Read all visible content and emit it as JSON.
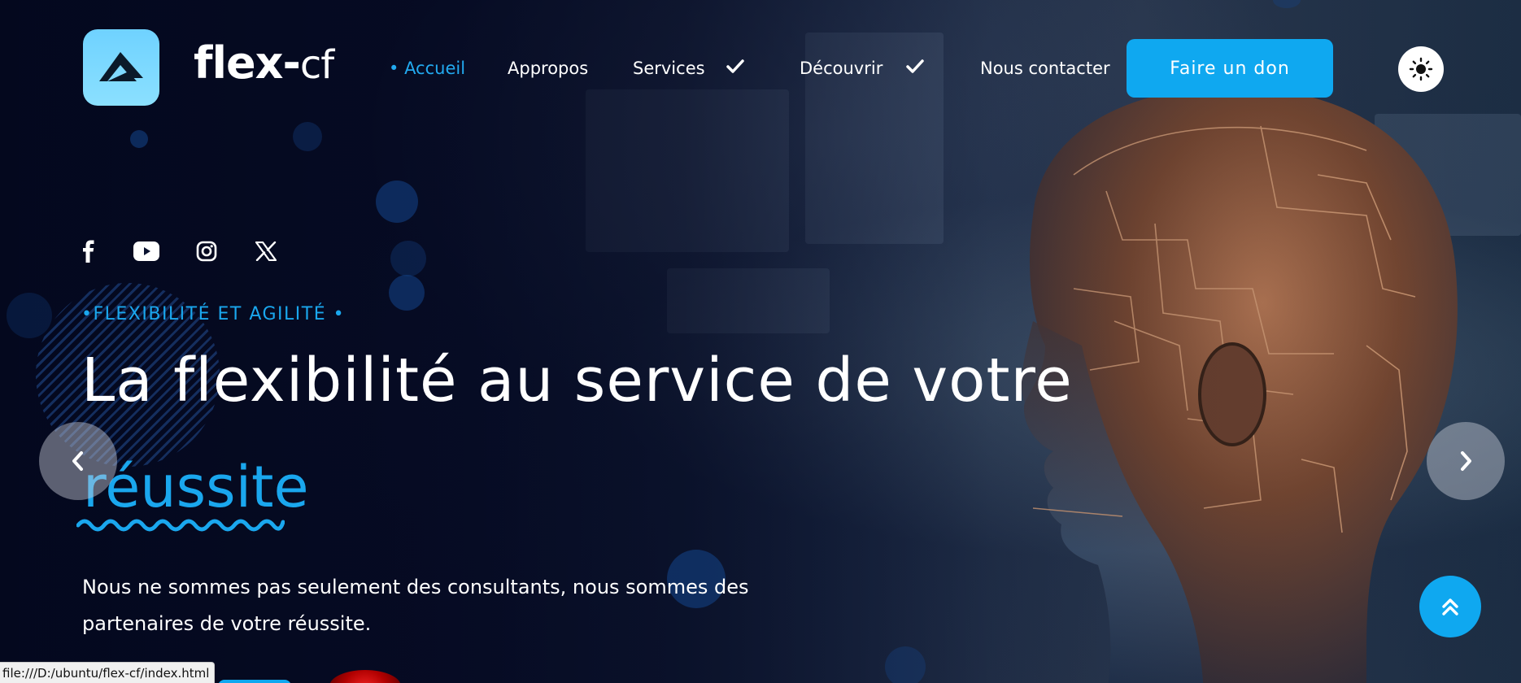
{
  "header": {
    "brand": "flex-cf",
    "brand_main": "flex",
    "brand_dash": "-",
    "brand_suffix": "cf",
    "nav": [
      {
        "label": "Accueil",
        "active": true
      },
      {
        "label": "Appropos",
        "active": false
      },
      {
        "label": "Services",
        "active": false,
        "has_dropdown": true
      },
      {
        "label": "Découvrir",
        "active": false,
        "has_dropdown": true
      },
      {
        "label": "Nous contacter",
        "active": false
      }
    ],
    "cta_label": "Faire un don",
    "theme_icon": "sun-icon"
  },
  "social": [
    "facebook-icon",
    "youtube-icon",
    "instagram-icon",
    "x-icon"
  ],
  "hero": {
    "eyebrow": "•FLEXIBILITÉ ET AGILITÉ •",
    "headline": "La flexibilité au service de votre",
    "headline_highlight": "réussite",
    "description": "Nous ne sommes pas seulement des consultants, nous sommes des partenaires de votre réussite."
  },
  "status_bar": {
    "url": "file:///D:/ubuntu/flex-cf/index.html"
  },
  "colors": {
    "accent": "#0fa8f0",
    "accent_text": "#1aa7ee",
    "background": "#050c24",
    "text": "#ffffff"
  }
}
